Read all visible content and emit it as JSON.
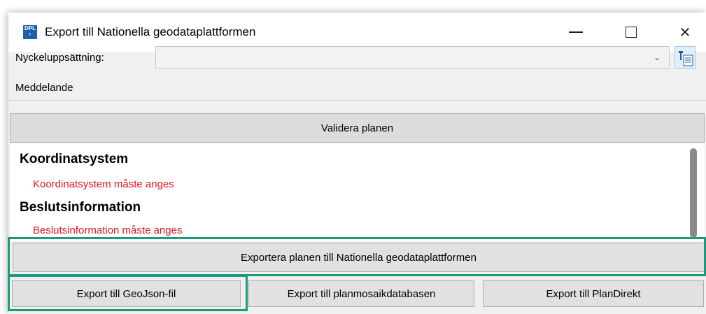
{
  "window": {
    "title": "Export till Nationella geodataplattformen",
    "app_icon": "DPL-app-icon",
    "app_icon_text": "DPL",
    "app_icon_subtext": "r",
    "controls": [
      "minimize-icon",
      "maximize-icon",
      "close-icon"
    ],
    "close_glyph": "✕"
  },
  "key_set": {
    "label": "Nyckeluppsättning:",
    "value": "",
    "arrow": "⌄",
    "tool_icon": "key-list-icon"
  },
  "message_group": {
    "legend": "Meddelande"
  },
  "buttons": {
    "validate": "Validera planen",
    "export_national": "Exportera planen till Nationella geodataplattformen",
    "export_geojson": "Export till GeoJson-fil",
    "export_planmosaik": "Export till planmosaikdatabasen",
    "export_plandirekt": "Export till PlanDirekt"
  },
  "messages": [
    {
      "heading": "Koordinatsystem",
      "error": "Koordinatsystem måste anges"
    },
    {
      "heading": "Beslutsinformation",
      "error": "Beslutsinformation måste anges"
    }
  ],
  "colors": {
    "error": "#e8161c",
    "highlight": "#1b9a7e",
    "app_icon": "#1f5fae"
  }
}
